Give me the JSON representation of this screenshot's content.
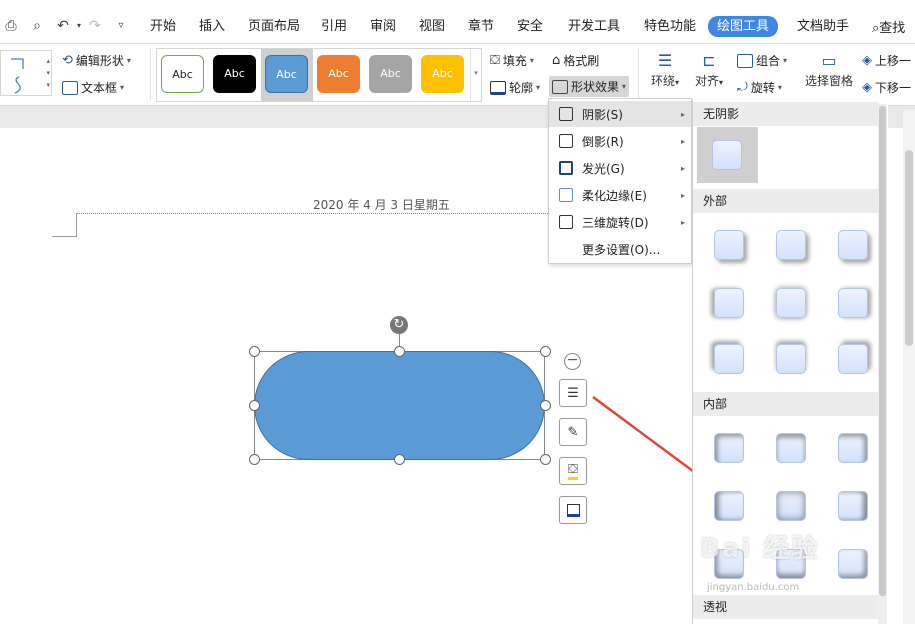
{
  "tabs": {
    "home": "开始",
    "insert": "插入",
    "page_layout": "页面布局",
    "reference": "引用",
    "review": "审阅",
    "view": "视图",
    "chapter": "章节",
    "security": "安全",
    "developer": "开发工具",
    "features": "特色功能",
    "drawing_tools": "绘图工具",
    "doc_assistant": "文档助手",
    "search": "查找"
  },
  "ribbon": {
    "edit_shape": "编辑形状",
    "text_box": "文本框",
    "swatch_label": "Abc",
    "fill": "填充",
    "format_brush": "格式刷",
    "outline": "轮廓",
    "shape_effects": "形状效果",
    "wrap": "环绕",
    "align": "对齐",
    "group": "组合",
    "rotate": "旋转",
    "selection_pane": "选择窗格",
    "bring_forward": "上移一",
    "send_backward": "下移一"
  },
  "colors": {
    "accent": "#3f86e6",
    "shape_fill": "#5b9bd5",
    "arrow": "#e8413a",
    "swatches": [
      "#ffffff",
      "#000000",
      "#5b9bd5",
      "#ed7d31",
      "#a5a5a5",
      "#ffc000"
    ]
  },
  "document": {
    "header_date": "2020 年 4 月 3 日星期五"
  },
  "effects_menu": {
    "shadow": "阴影(S)",
    "reflection": "倒影(R)",
    "glow": "发光(G)",
    "soft_edges": "柔化边缘(E)",
    "rotation_3d": "三维旋转(D)",
    "more": "更多设置(O)..."
  },
  "shadow_panel": {
    "no_shadow": "无阴影",
    "outer": "外部",
    "inner": "内部",
    "perspective": "透视"
  },
  "watermark": {
    "text": "Bai 经验",
    "sub": "jingyan.baidu.com"
  }
}
